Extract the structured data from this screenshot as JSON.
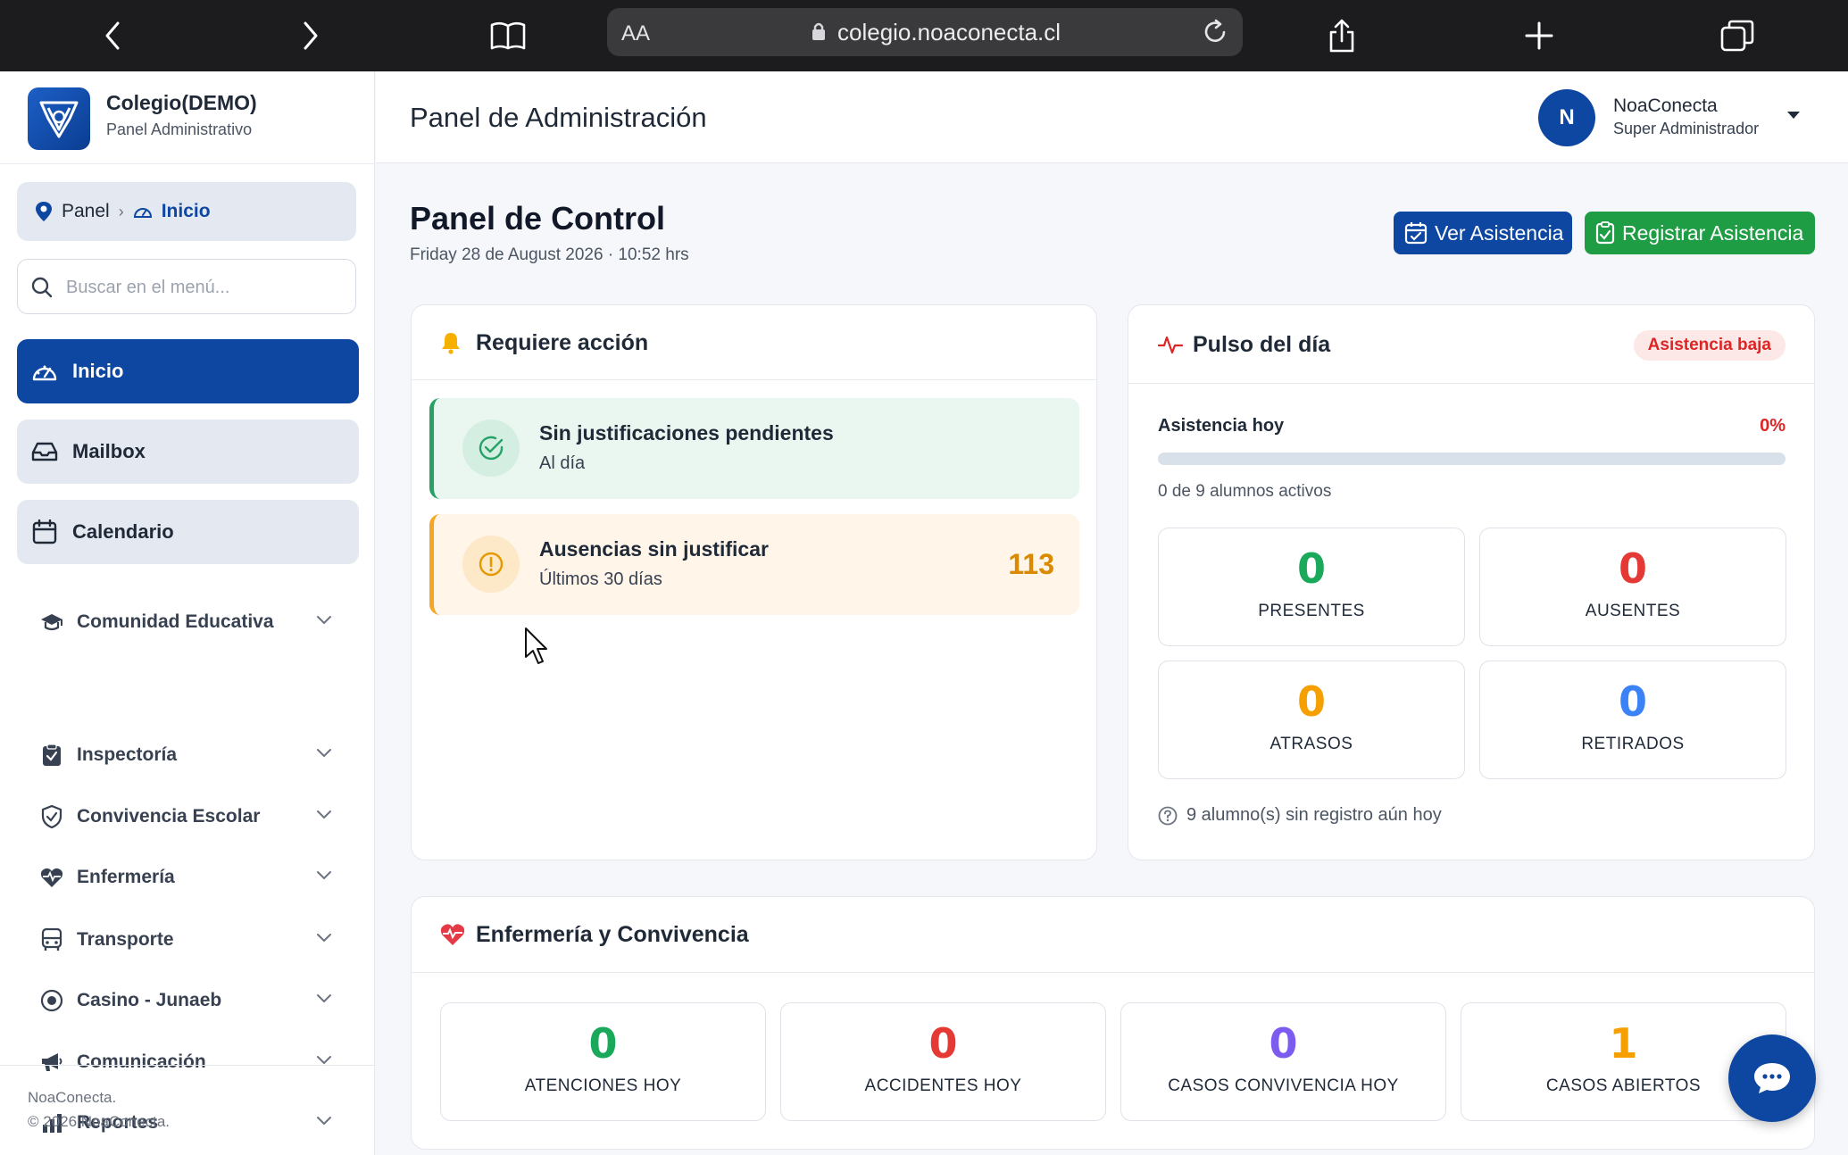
{
  "browser": {
    "aa_label": "AA",
    "url": "colegio.noaconecta.cl"
  },
  "sidebar": {
    "brand_name": "Colegio(DEMO)",
    "brand_sub": "Panel Administrativo",
    "breadcrumb": {
      "root": "Panel",
      "sep": "›",
      "current": "Inicio"
    },
    "search_placeholder": "Buscar en el menú...",
    "pills": [
      {
        "label": "Inicio",
        "icon": "dashboard-icon"
      },
      {
        "label": "Mailbox",
        "icon": "inbox-icon"
      },
      {
        "label": "Calendario",
        "icon": "calendar-icon"
      }
    ],
    "sections": [
      {
        "label": "Comunidad Educativa",
        "icon": "graduation-cap-icon"
      },
      {
        "label": "Inspectoría",
        "icon": "clipboard-icon"
      },
      {
        "label": "Convivencia Escolar",
        "icon": "shield-icon"
      },
      {
        "label": "Enfermería",
        "icon": "heart-pulse-icon"
      },
      {
        "label": "Transporte",
        "icon": "bus-icon"
      },
      {
        "label": "Casino - Junaeb",
        "icon": "plate-icon"
      },
      {
        "label": "Comunicación",
        "icon": "megaphone-icon"
      },
      {
        "label": "Reportes",
        "icon": "bar-chart-icon"
      }
    ],
    "footer_name": "NoaConecta.",
    "footer_copy": "© 2026 NoaConecta."
  },
  "header": {
    "title": "Panel de Administración",
    "avatar_initial": "N",
    "user_name": "NoaConecta",
    "user_role": "Super Administrador"
  },
  "main": {
    "title": "Panel de Control",
    "date": "Friday 28 de August 2026 · 10:52 hrs",
    "btn_ver": "Ver Asistencia",
    "btn_registrar": "Registrar Asistencia"
  },
  "requiere": {
    "title": "Requiere acción",
    "ok": {
      "title": "Sin justificaciones pendientes",
      "sub": "Al día"
    },
    "warn": {
      "title": "Ausencias sin justificar",
      "sub": "Últimos 30 días",
      "count": "113"
    }
  },
  "pulso": {
    "title": "Pulso del día",
    "badge": "Asistencia baja",
    "asistencia_label": "Asistencia hoy",
    "asistencia_pct": "0%",
    "asistencia_fraction": 0,
    "alumnos_activos": "0 de 9 alumnos activos",
    "stats": [
      {
        "value": "0",
        "label": "PRESENTES",
        "color": "#1aa95b"
      },
      {
        "value": "0",
        "label": "AUSENTES",
        "color": "#e53935"
      },
      {
        "value": "0",
        "label": "ATRASOS",
        "color": "#f5a000"
      },
      {
        "value": "0",
        "label": "RETIRADOS",
        "color": "#3b82f6"
      }
    ],
    "note": "9 alumno(s) sin registro aún hoy"
  },
  "enfermeria": {
    "title": "Enfermería y Convivencia",
    "stats": [
      {
        "value": "0",
        "label": "ATENCIONES HOY",
        "color": "#1aa95b"
      },
      {
        "value": "0",
        "label": "ACCIDENTES HOY",
        "color": "#e53935"
      },
      {
        "value": "0",
        "label": "CASOS CONVIVENCIA HOY",
        "color": "#7c5cf0"
      },
      {
        "value": "1",
        "label": "CASOS ABIERTOS",
        "color": "#f5a000"
      }
    ]
  }
}
